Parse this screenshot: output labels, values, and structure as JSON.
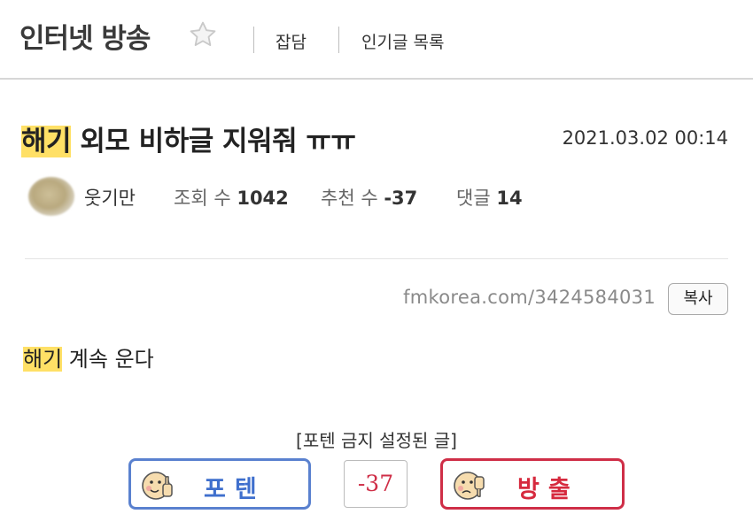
{
  "board": {
    "title": "인터넷 방송",
    "favorite_icon": "star-icon"
  },
  "nav": {
    "links": [
      "잡담",
      "인기글 목록"
    ]
  },
  "post": {
    "title_highlight": "해기",
    "title_rest": " 외모 비하글 지워줘 ㅠㅠ",
    "date": "2021.03.02 00:14",
    "author": "웃기만",
    "views_label": "조회 수",
    "views": "1042",
    "recommend_label": "추천 수",
    "recommend": "-37",
    "comments_label": "댓글",
    "comments": "14",
    "url": "fmkorea.com/3424584031",
    "copy_label": "복사",
    "content_highlight": "해기",
    "content_rest": " 계속 운다"
  },
  "vote": {
    "notice": "[포텐 금지 설정된 글]",
    "up_label": "포텐",
    "count": "-37",
    "down_label": "방출",
    "colors": {
      "up": "#5a81cf",
      "down": "#cf2e47"
    }
  }
}
